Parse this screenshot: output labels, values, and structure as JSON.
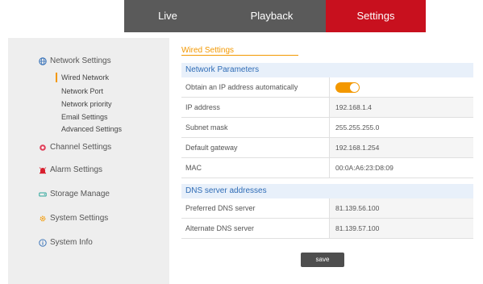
{
  "top_nav": {
    "items": [
      {
        "label": "Live",
        "active": false
      },
      {
        "label": "Playback",
        "active": false
      },
      {
        "label": "Settings",
        "active": true
      }
    ]
  },
  "sidebar": {
    "groups": [
      {
        "label": "Network Settings",
        "icon": "globe-icon",
        "color": "#2f6cb6",
        "items": [
          "Wired Network",
          "Network Port",
          "Network priority",
          "Email Settings",
          "Advanced Settings"
        ]
      },
      {
        "label": "Channel Settings",
        "icon": "camera-icon",
        "color": "#e0405a"
      },
      {
        "label": "Alarm Settings",
        "icon": "alarm-icon",
        "color": "#d8202e"
      },
      {
        "label": "Storage Manage",
        "icon": "storage-icon",
        "color": "#2aa59a"
      },
      {
        "label": "System Settings",
        "icon": "gear-icon",
        "color": "#f39800"
      },
      {
        "label": "System Info",
        "icon": "info-icon",
        "color": "#2f6cb6"
      }
    ],
    "active_item": "Wired Network"
  },
  "main": {
    "title": "Wired Settings",
    "network_parameters": {
      "header": "Network Parameters",
      "rows": [
        {
          "label": "Obtain an IP address automatically",
          "value": "",
          "toggle_on": true
        },
        {
          "label": "IP address",
          "value": "192.168.1.4"
        },
        {
          "label": "Subnet mask",
          "value": "255.255.255.0"
        },
        {
          "label": "Default gateway",
          "value": "192.168.1.254"
        },
        {
          "label": "MAC",
          "value": "00:0A:A6:23:D8:09"
        }
      ]
    },
    "dns": {
      "header": "DNS server addresses",
      "rows": [
        {
          "label": "Preferred DNS server",
          "value": "81.139.56.100"
        },
        {
          "label": "Alternate DNS server",
          "value": "81.139.57.100"
        }
      ]
    },
    "save_label": "save"
  },
  "colors": {
    "accent": "#f39800",
    "active_tab": "#c8101e",
    "topbar": "#5a5a5a",
    "section_header": "#e8f0fa",
    "section_header_text": "#2f6cb6"
  }
}
